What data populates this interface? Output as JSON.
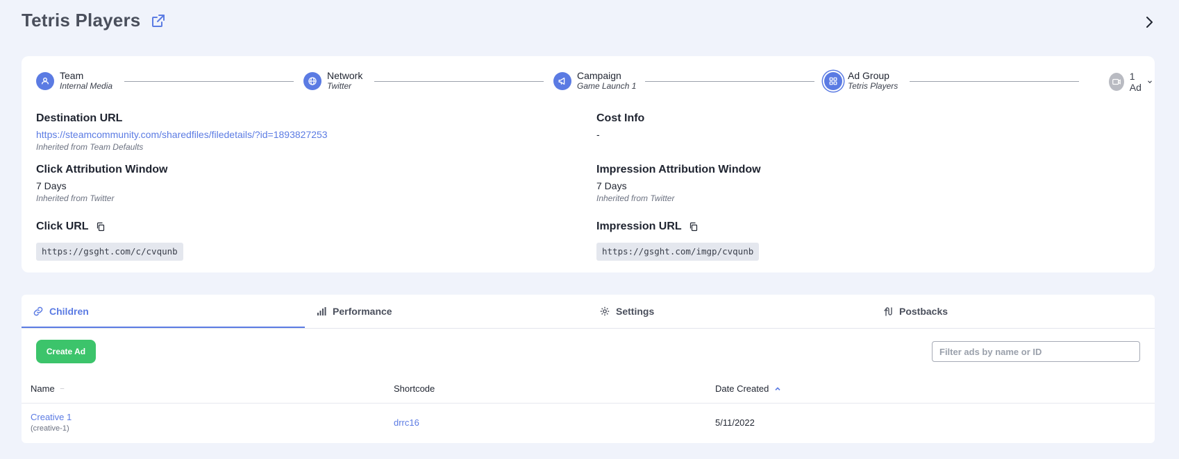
{
  "header": {
    "title": "Tetris Players",
    "open_external_icon": "external-link-icon",
    "expand_icon": "chevron-right-icon"
  },
  "breadcrumb": {
    "steps": [
      {
        "label": "Team",
        "sub": "Internal Media",
        "icon": "team-icon"
      },
      {
        "label": "Network",
        "sub": "Twitter",
        "icon": "globe-icon"
      },
      {
        "label": "Campaign",
        "sub": "Game Launch 1",
        "icon": "megaphone-icon"
      },
      {
        "label": "Ad Group",
        "sub": "Tetris Players",
        "icon": "grid-icon"
      }
    ],
    "ads": {
      "label": "1 Ad",
      "icon": "ads-icon"
    }
  },
  "details": {
    "destination": {
      "title": "Destination URL",
      "value": "https://steamcommunity.com/sharedfiles/filedetails/?id=1893827253",
      "note": "Inherited from Team Defaults"
    },
    "cost": {
      "title": "Cost Info",
      "value": "-"
    },
    "click_window": {
      "title": "Click Attribution Window",
      "value": "7 Days",
      "note": "Inherited from Twitter"
    },
    "impression_window": {
      "title": "Impression Attribution Window",
      "value": "7 Days",
      "note": "Inherited from Twitter"
    },
    "click_url": {
      "title": "Click URL",
      "value": "https://gsght.com/c/cvqunb"
    },
    "impression_url": {
      "title": "Impression URL",
      "value": "https://gsght.com/imgp/cvqunb"
    }
  },
  "tabs": [
    {
      "label": "Children",
      "icon": "link-icon",
      "active": true
    },
    {
      "label": "Performance",
      "icon": "bar-chart-icon",
      "active": false
    },
    {
      "label": "Settings",
      "icon": "gear-icon",
      "active": false
    },
    {
      "label": "Postbacks",
      "icon": "postback-icon",
      "active": false
    }
  ],
  "children": {
    "create_button": "Create Ad",
    "filter_placeholder": "Filter ads by name or ID",
    "filter_value": "",
    "columns": [
      "Name",
      "Shortcode",
      "Date Created"
    ],
    "rows": [
      {
        "name": "Creative 1",
        "slug": "(creative-1)",
        "shortcode": "drrc16",
        "date": "5/11/2022"
      }
    ]
  },
  "colors": {
    "accent": "#5b7be3",
    "success": "#3cc46b",
    "background": "#f0f3fb"
  }
}
